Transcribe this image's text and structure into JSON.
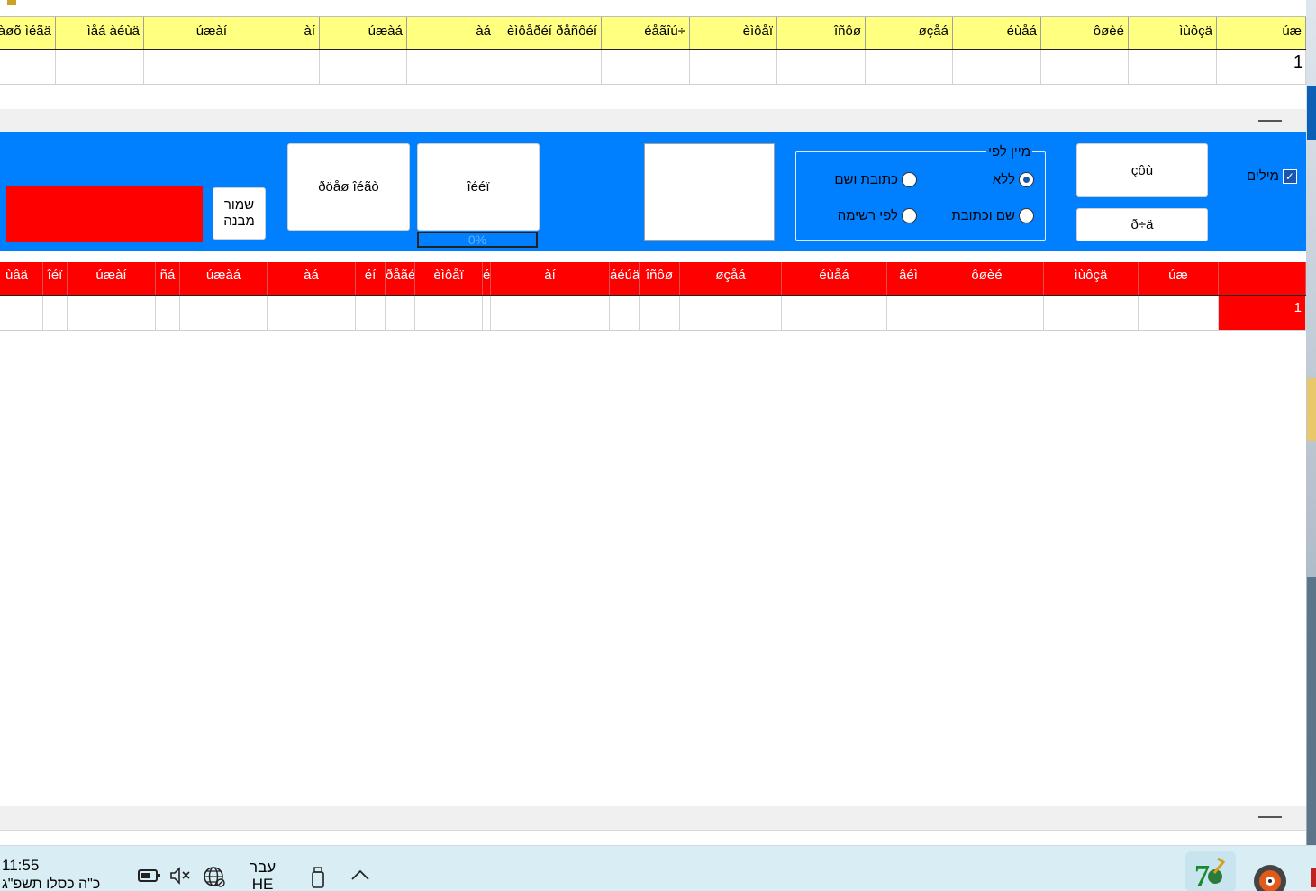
{
  "grid_top": {
    "headers": [
      "úæ",
      "ìùôçä",
      "ôøèé",
      "éùåá",
      "øçåá",
      "îñôø",
      "èìôåï",
      "éåãîú÷",
      "èìôåðéí ðåñôéí",
      "àá",
      "úæàá",
      "àí",
      "úæàí",
      "ìåá àéùä",
      "àøõ ìéãä"
    ],
    "row_value": "1"
  },
  "panel": {
    "save_button": "שמור מבנה",
    "export_button": "ðöåø îéãò",
    "sort_button": "îééï",
    "progress_text": "0%",
    "search_button": "çôù",
    "clear_button": "ð÷ä",
    "group_legend": "מיין לפי",
    "radio_none": "ללא",
    "radio_address_name": "כתובת ושם",
    "radio_name_address": "שם וכתובת",
    "radio_by_list": "לפי רשימה",
    "checkbox_label": "מילים",
    "checkbox_mark": "✓"
  },
  "grid_bottom": {
    "headers": [
      "",
      "úæ",
      "ìùôçä",
      "ôøèé",
      "âéì",
      "éùåá",
      "øçåá",
      "îñôø",
      "áéúä",
      "àí",
      "é",
      "èìôåï",
      "ðåãéò",
      "éí",
      "àá",
      "úæàá",
      "ñá",
      "úæàí",
      "îéï",
      "ùâä"
    ],
    "row_value": "1"
  },
  "taskbar": {
    "time": "11:55",
    "date": "כ\"ה כסלו תשפ\"ג",
    "lang_top": "עבר",
    "lang_bottom": "HE"
  },
  "colors": {
    "panel_blue": "#0080ff",
    "header_yellow": "#ffff80",
    "header_red": "#ff0000"
  }
}
